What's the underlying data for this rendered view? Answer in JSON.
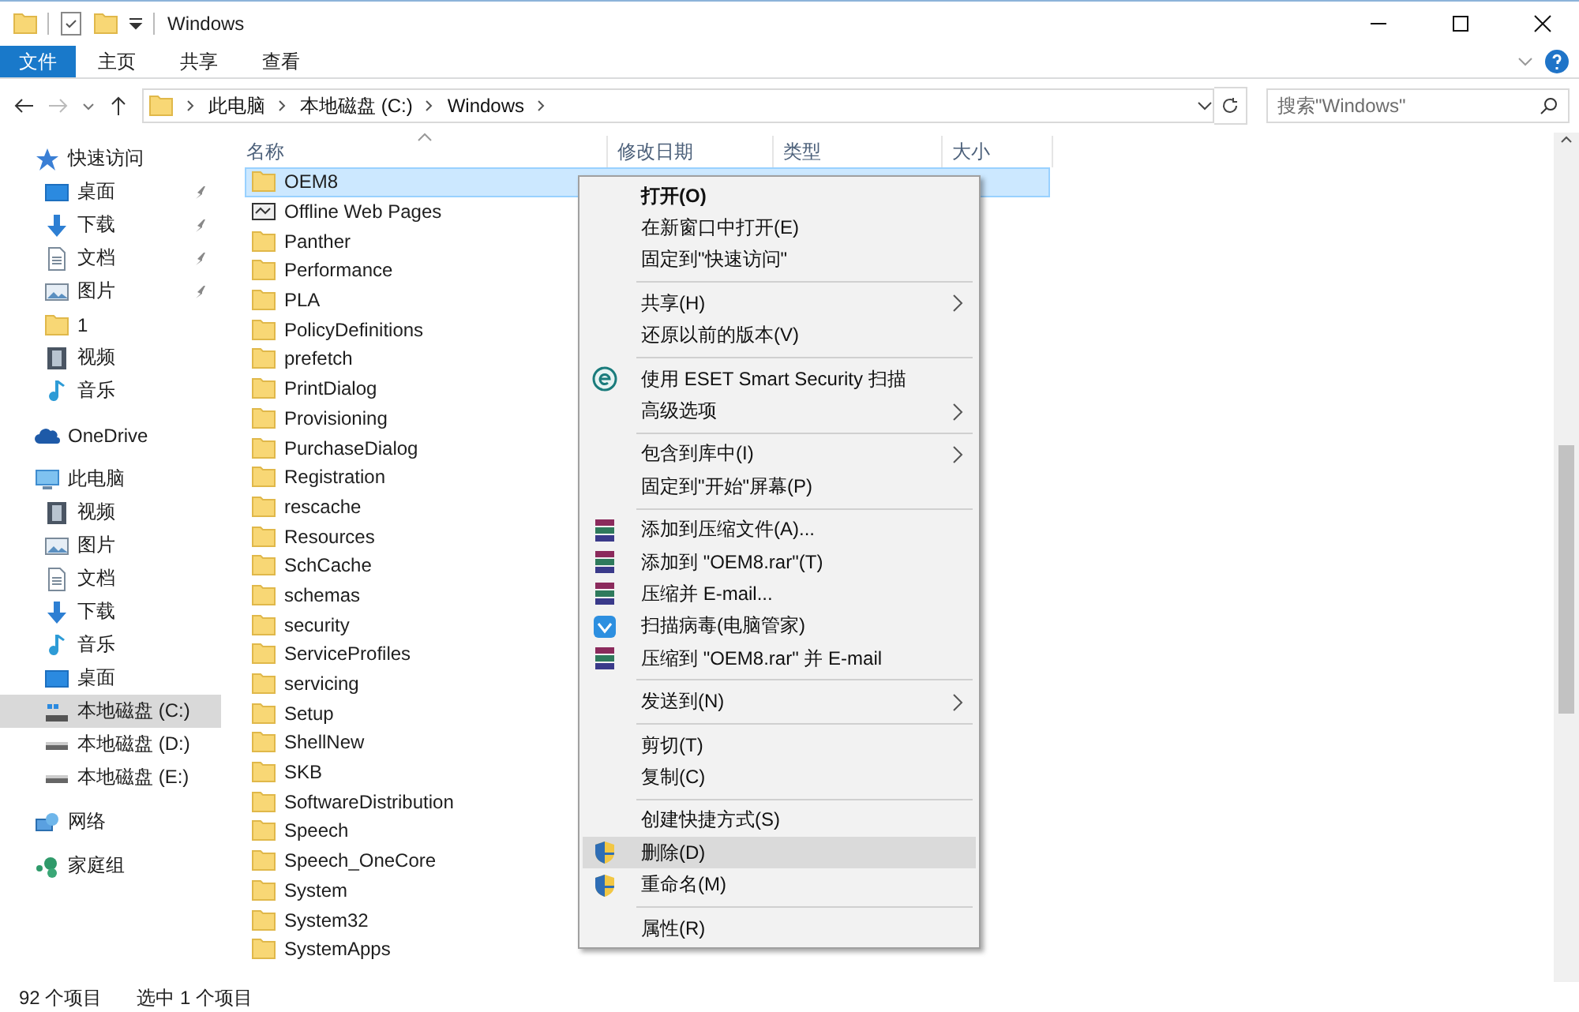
{
  "window": {
    "title": "Windows"
  },
  "ribbon": {
    "tabs": [
      {
        "label": "文件",
        "kind": "file"
      },
      {
        "label": "主页",
        "kind": "tab"
      },
      {
        "label": "共享",
        "kind": "tab"
      },
      {
        "label": "查看",
        "kind": "tab"
      }
    ]
  },
  "address": {
    "path": [
      "此电脑",
      "本地磁盘 (C:)",
      "Windows"
    ],
    "search_placeholder": "搜索\"Windows\""
  },
  "nav": [
    {
      "label": "快速访问",
      "kind": "star",
      "selected": false,
      "pinned": false,
      "children": [
        {
          "label": "桌面",
          "kind": "desktop",
          "selected": false,
          "pinned": true
        },
        {
          "label": "下载",
          "kind": "download",
          "selected": false,
          "pinned": true
        },
        {
          "label": "文档",
          "kind": "doc",
          "selected": false,
          "pinned": true
        },
        {
          "label": "图片",
          "kind": "pictures",
          "selected": false,
          "pinned": true
        },
        {
          "label": "1",
          "kind": "folder",
          "selected": false,
          "pinned": false
        },
        {
          "label": "视频",
          "kind": "video",
          "selected": false,
          "pinned": false
        },
        {
          "label": "音乐",
          "kind": "music",
          "selected": false,
          "pinned": false
        }
      ]
    },
    {
      "label": "OneDrive",
      "kind": "cloud",
      "selected": false,
      "pinned": false
    },
    {
      "label": "此电脑",
      "kind": "pc",
      "selected": false,
      "pinned": false,
      "children": [
        {
          "label": "视频",
          "kind": "video",
          "selected": false,
          "pinned": false
        },
        {
          "label": "图片",
          "kind": "pictures",
          "selected": false,
          "pinned": false
        },
        {
          "label": "文档",
          "kind": "doc",
          "selected": false,
          "pinned": false
        },
        {
          "label": "下载",
          "kind": "download",
          "selected": false,
          "pinned": false
        },
        {
          "label": "音乐",
          "kind": "music",
          "selected": false,
          "pinned": false
        },
        {
          "label": "桌面",
          "kind": "desktop",
          "selected": false,
          "pinned": false
        },
        {
          "label": "本地磁盘 (C:)",
          "kind": "sysdrive",
          "selected": true,
          "pinned": false
        },
        {
          "label": "本地磁盘 (D:)",
          "kind": "drive",
          "selected": false,
          "pinned": false
        },
        {
          "label": "本地磁盘 (E:)",
          "kind": "drive",
          "selected": false,
          "pinned": false
        }
      ]
    },
    {
      "label": "网络",
      "kind": "network",
      "selected": false,
      "pinned": false
    },
    {
      "label": "家庭组",
      "kind": "homegroup",
      "selected": false,
      "pinned": false
    }
  ],
  "table": {
    "columns": [
      "名称",
      "修改日期",
      "类型",
      "大小"
    ],
    "rows": [
      {
        "name": "OEM8",
        "kind": "folder",
        "selected": true
      },
      {
        "name": "Offline Web Pages",
        "kind": "web",
        "selected": false
      },
      {
        "name": "Panther",
        "kind": "folder",
        "selected": false
      },
      {
        "name": "Performance",
        "kind": "folder",
        "selected": false
      },
      {
        "name": "PLA",
        "kind": "folder",
        "selected": false
      },
      {
        "name": "PolicyDefinitions",
        "kind": "folder",
        "selected": false
      },
      {
        "name": "prefetch",
        "kind": "folder",
        "selected": false
      },
      {
        "name": "PrintDialog",
        "kind": "folder",
        "selected": false
      },
      {
        "name": "Provisioning",
        "kind": "folder",
        "selected": false
      },
      {
        "name": "PurchaseDialog",
        "kind": "folder",
        "selected": false
      },
      {
        "name": "Registration",
        "kind": "folder",
        "selected": false
      },
      {
        "name": "rescache",
        "kind": "folder",
        "selected": false
      },
      {
        "name": "Resources",
        "kind": "folder",
        "selected": false
      },
      {
        "name": "SchCache",
        "kind": "folder",
        "selected": false
      },
      {
        "name": "schemas",
        "kind": "folder",
        "selected": false
      },
      {
        "name": "security",
        "kind": "folder",
        "selected": false
      },
      {
        "name": "ServiceProfiles",
        "kind": "folder",
        "selected": false
      },
      {
        "name": "servicing",
        "kind": "folder",
        "selected": false
      },
      {
        "name": "Setup",
        "kind": "folder",
        "selected": false
      },
      {
        "name": "ShellNew",
        "kind": "folder",
        "selected": false
      },
      {
        "name": "SKB",
        "kind": "folder",
        "selected": false
      },
      {
        "name": "SoftwareDistribution",
        "kind": "folder",
        "selected": false
      },
      {
        "name": "Speech",
        "kind": "folder",
        "selected": false
      },
      {
        "name": "Speech_OneCore",
        "kind": "folder",
        "selected": false
      },
      {
        "name": "System",
        "kind": "folder",
        "selected": false
      },
      {
        "name": "System32",
        "kind": "folder",
        "selected": false
      },
      {
        "name": "SystemApps",
        "kind": "folder",
        "selected": false
      }
    ]
  },
  "context_menu": [
    {
      "kind": "default",
      "label": "打开(O)",
      "submenu": false,
      "selected": false
    },
    {
      "kind": "plain",
      "label": "在新窗口中打开(E)",
      "submenu": false,
      "selected": false
    },
    {
      "kind": "plain",
      "label": "固定到\"快速访问\"",
      "submenu": false,
      "selected": false
    },
    {
      "kind": "separator"
    },
    {
      "kind": "plain",
      "label": "共享(H)",
      "submenu": true,
      "selected": false
    },
    {
      "kind": "plain",
      "label": "还原以前的版本(V)",
      "submenu": false,
      "selected": false
    },
    {
      "kind": "separator"
    },
    {
      "kind": "eset",
      "label": "使用 ESET Smart Security 扫描",
      "submenu": false,
      "selected": false
    },
    {
      "kind": "plain",
      "label": "高级选项",
      "submenu": true,
      "selected": false
    },
    {
      "kind": "separator"
    },
    {
      "kind": "plain",
      "label": "包含到库中(I)",
      "submenu": true,
      "selected": false
    },
    {
      "kind": "plain",
      "label": "固定到\"开始\"屏幕(P)",
      "submenu": false,
      "selected": false
    },
    {
      "kind": "separator"
    },
    {
      "kind": "archive",
      "label": "添加到压缩文件(A)...",
      "submenu": false,
      "selected": false
    },
    {
      "kind": "archive",
      "label": "添加到 \"OEM8.rar\"(T)",
      "submenu": false,
      "selected": false
    },
    {
      "kind": "archive",
      "label": "压缩并 E-mail...",
      "submenu": false,
      "selected": false
    },
    {
      "kind": "guard",
      "label": "扫描病毒(电脑管家)",
      "submenu": false,
      "selected": false
    },
    {
      "kind": "archive",
      "label": "压缩到 \"OEM8.rar\" 并 E-mail",
      "submenu": false,
      "selected": false
    },
    {
      "kind": "separator"
    },
    {
      "kind": "plain",
      "label": "发送到(N)",
      "submenu": true,
      "selected": false
    },
    {
      "kind": "separator"
    },
    {
      "kind": "plain",
      "label": "剪切(T)",
      "submenu": false,
      "selected": false
    },
    {
      "kind": "plain",
      "label": "复制(C)",
      "submenu": false,
      "selected": false
    },
    {
      "kind": "separator"
    },
    {
      "kind": "plain",
      "label": "创建快捷方式(S)",
      "submenu": false,
      "selected": false
    },
    {
      "kind": "shield",
      "label": "删除(D)",
      "submenu": false,
      "selected": true
    },
    {
      "kind": "shield",
      "label": "重命名(M)",
      "submenu": false,
      "selected": false
    },
    {
      "kind": "separator"
    },
    {
      "kind": "plain",
      "label": "属性(R)",
      "submenu": false,
      "selected": false
    }
  ],
  "status_bar": {
    "item_count": "92 个项目",
    "selection": "选中 1 个项目"
  }
}
